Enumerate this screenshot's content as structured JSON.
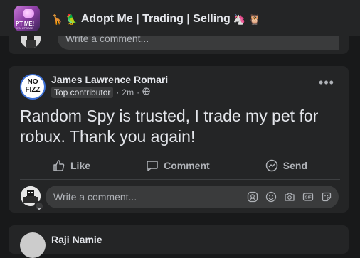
{
  "header": {
    "group_title": "Adopt Me | Trading | Selling",
    "group_thumb_text": "PT ME!",
    "group_thumb_sub": "WN UPDATE"
  },
  "comment_box": {
    "placeholder": "Write a comment..."
  },
  "post": {
    "author": "James Lawrence Romari",
    "badge": "Top contributor",
    "time": "2m",
    "audience_icon": "globe-icon",
    "text": "Random Spy is trusted, I trade my pet for robux. Thank you again!",
    "avatar_logo": "NO FIZZ",
    "actions": {
      "like": "Like",
      "comment": "Comment",
      "send": "Send"
    }
  },
  "next_post": {
    "author": "Raji Namie"
  },
  "colors": {
    "background": "#18191a",
    "card": "#242526",
    "input": "#3a3b3c",
    "text_primary": "#e4e6eb",
    "text_secondary": "#b0b3b8"
  }
}
